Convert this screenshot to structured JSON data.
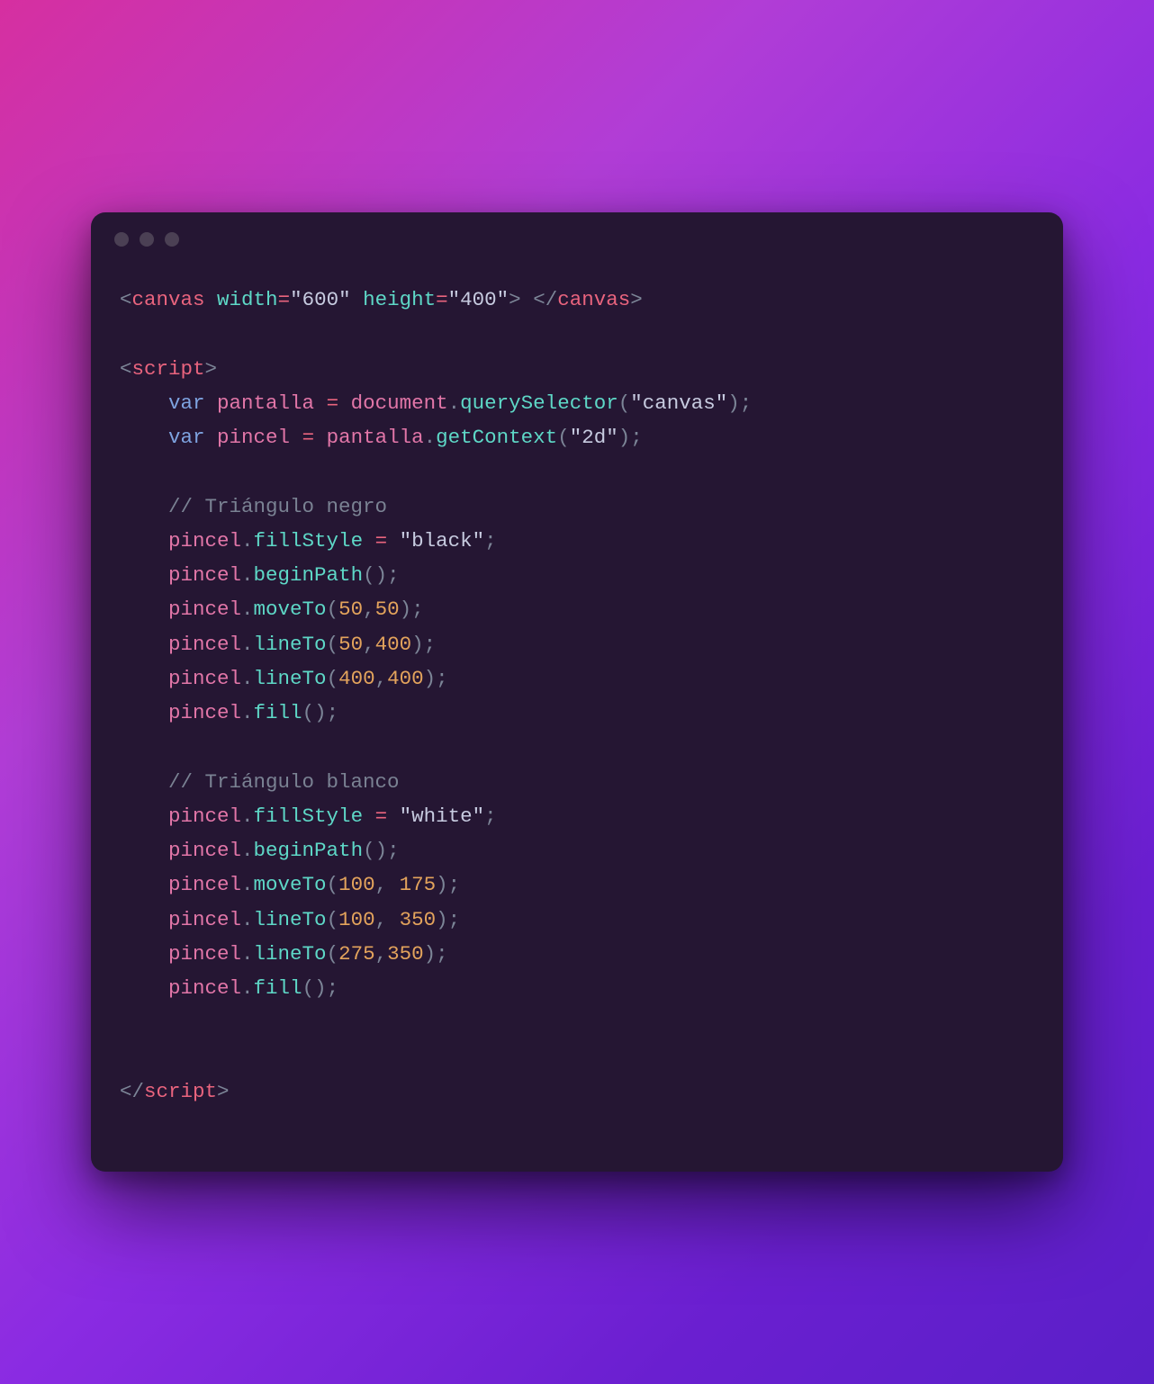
{
  "window": {
    "dots": 3
  },
  "code": {
    "canvas_tag_open": "canvas",
    "attr_width_name": "width",
    "attr_width_eq": "=",
    "attr_width_val": "\"600\"",
    "attr_height_name": "height",
    "attr_height_eq": "=",
    "attr_height_val": "\"400\"",
    "canvas_tag_close": "canvas",
    "script_tag_open": "script",
    "kw_var1": "var",
    "ident_pantalla1": "pantalla",
    "eq1": "=",
    "ident_document": "document",
    "dot1": ".",
    "method_qs": "querySelector",
    "paren_open1": "(",
    "str_canvas": "\"canvas\"",
    "paren_close1": ")",
    "semi1": ";",
    "kw_var2": "var",
    "ident_pincel1": "pincel",
    "eq2": "=",
    "ident_pantalla2": "pantalla",
    "dot2": ".",
    "method_gc": "getContext",
    "paren_open2": "(",
    "str_2d": "\"2d\"",
    "paren_close2": ")",
    "semi2": ";",
    "comment1": "// Triángulo negro",
    "ident_pincel_fs1": "pincel",
    "dot_fs1": ".",
    "prop_fillstyle1": "fillStyle",
    "eq_fs1": "=",
    "str_black": "\"black\"",
    "semi_fs1": ";",
    "ident_pincel_bp1": "pincel",
    "dot_bp1": ".",
    "method_bp1": "beginPath",
    "paren_bp1o": "(",
    "paren_bp1c": ")",
    "semi_bp1": ";",
    "ident_pincel_mt1": "pincel",
    "dot_mt1": ".",
    "method_mt1": "moveTo",
    "paren_mt1o": "(",
    "num_mt1a": "50",
    "comma_mt1": ",",
    "num_mt1b": "50",
    "paren_mt1c": ")",
    "semi_mt1": ";",
    "ident_pincel_lt1": "pincel",
    "dot_lt1": ".",
    "method_lt1": "lineTo",
    "paren_lt1o": "(",
    "num_lt1a": "50",
    "comma_lt1": ",",
    "num_lt1b": "400",
    "paren_lt1c": ")",
    "semi_lt1": ";",
    "ident_pincel_lt2": "pincel",
    "dot_lt2": ".",
    "method_lt2": "lineTo",
    "paren_lt2o": "(",
    "num_lt2a": "400",
    "comma_lt2": ",",
    "num_lt2b": "400",
    "paren_lt2c": ")",
    "semi_lt2": ";",
    "ident_pincel_fl1": "pincel",
    "dot_fl1": ".",
    "method_fl1": "fill",
    "paren_fl1o": "(",
    "paren_fl1c": ")",
    "semi_fl1": ";",
    "comment2": "// Triángulo blanco",
    "ident_pincel_fs2": "pincel",
    "dot_fs2": ".",
    "prop_fillstyle2": "fillStyle",
    "eq_fs2": "=",
    "str_white": "\"white\"",
    "semi_fs2": ";",
    "ident_pincel_bp2": "pincel",
    "dot_bp2": ".",
    "method_bp2": "beginPath",
    "paren_bp2o": "(",
    "paren_bp2c": ")",
    "semi_bp2": ";",
    "ident_pincel_mt2": "pincel",
    "dot_mt2": ".",
    "method_mt2": "moveTo",
    "paren_mt2o": "(",
    "num_mt2a": "100",
    "comma_mt2": ",",
    "sp_mt2": " ",
    "num_mt2b": "175",
    "paren_mt2c": ")",
    "semi_mt2": ";",
    "ident_pincel_lt3": "pincel",
    "dot_lt3": ".",
    "method_lt3": "lineTo",
    "paren_lt3o": "(",
    "num_lt3a": "100",
    "comma_lt3": ",",
    "sp_lt3": " ",
    "num_lt3b": "350",
    "paren_lt3c": ")",
    "semi_lt3": ";",
    "ident_pincel_lt4": "pincel",
    "dot_lt4": ".",
    "method_lt4": "lineTo",
    "paren_lt4o": "(",
    "num_lt4a": "275",
    "comma_lt4": ",",
    "num_lt4b": "350",
    "paren_lt4c": ")",
    "semi_lt4": ";",
    "ident_pincel_fl2": "pincel",
    "dot_fl2": ".",
    "method_fl2": "fill",
    "paren_fl2o": "(",
    "paren_fl2c": ")",
    "semi_fl2": ";",
    "script_tag_close": "script",
    "lt": "<",
    "gt": ">",
    "lts": "</",
    "sp": " "
  }
}
